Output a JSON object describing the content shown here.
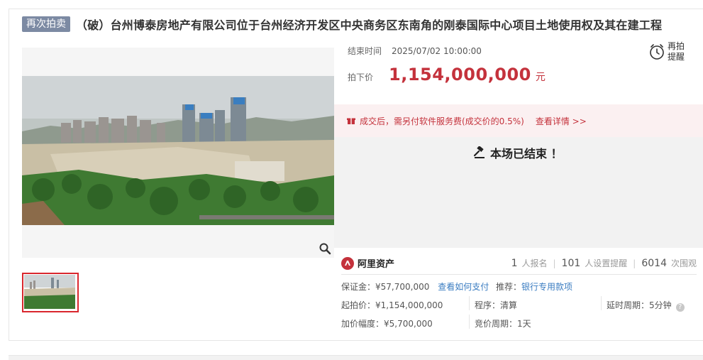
{
  "header": {
    "tag": "再次拍卖",
    "title": "（破）台州博泰房地产有限公司位于台州经济开发区中央商务区东南角的刚泰国际中心项目土地使用权及其在建工程"
  },
  "auction": {
    "end_label": "结束时间",
    "end_time": "2025/07/02 10:00:00",
    "price_label": "拍下价",
    "price": "1,154,000,000",
    "price_unit": "元",
    "remind_label_1": "再拍",
    "remind_label_2": "提醒"
  },
  "notice": {
    "text": "成交后，需另付软件服务费(成交价的0.5%)",
    "link": "查看详情 >>"
  },
  "status": {
    "text": "本场已结束 ！"
  },
  "platform": {
    "name": "阿里资产"
  },
  "stats": {
    "signups": "1",
    "signups_label": "人报名",
    "reminders": "101",
    "reminders_label": "人设置提醒",
    "views": "6014",
    "views_label": "次围观"
  },
  "details": {
    "deposit_label": "保证金：",
    "deposit": "¥57,700,000",
    "how_to_pay": "查看如何支付",
    "recommend_label": "推荐：",
    "recommend_link": "银行专用款项",
    "start_price_label": "起拍价：",
    "start_price": "¥1,154,000,000",
    "procedure_label": "程序：",
    "procedure": "清算",
    "delay_label": "延时周期：",
    "delay": "5分钟",
    "increment_label": "加价幅度：",
    "increment": "¥5,700,000",
    "bid_period_label": "竞价周期：",
    "bid_period": "1天"
  },
  "icons": {
    "zoom": "magnifier-icon",
    "alarm": "alarm-clock-icon",
    "gift": "gift-icon",
    "gavel": "gavel-icon",
    "logo": "ali-asset-logo-icon",
    "help": "help-icon"
  },
  "colors": {
    "accent": "#c4323c",
    "tag_bg": "#7c8aa3",
    "link": "#3a7cc1",
    "notice_bg": "#fbf0f1",
    "thumb_border": "#d9272e"
  }
}
